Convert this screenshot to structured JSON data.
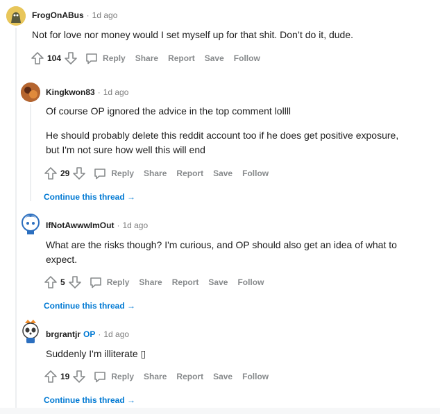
{
  "comments": [
    {
      "user": "FrogOnABus",
      "time": "1d ago",
      "body": "Not for love nor money would I set myself up for that shit. Don’t do it, dude.",
      "score": "104",
      "actions": {
        "reply": "Reply",
        "share": "Share",
        "report": "Report",
        "save": "Save",
        "follow": "Follow"
      }
    },
    {
      "user": "Kingkwon83",
      "time": "1d ago",
      "body1": "Of course OP ignored the advice in the top comment lollll",
      "body2": "He should probably delete this reddit account too if he does get positive exposure, but I'm not sure how well this will end",
      "score": "29",
      "actions": {
        "reply": "Reply",
        "share": "Share",
        "report": "Report",
        "save": "Save",
        "follow": "Follow"
      },
      "continue": "Continue this thread →"
    },
    {
      "user": "IfNotAwwwImOut",
      "time": "1d ago",
      "body": "What are the risks though? I'm curious, and OP should also get an idea of what to expect.",
      "score": "5",
      "actions": {
        "reply": "Reply",
        "share": "Share",
        "report": "Report",
        "save": "Save",
        "follow": "Follow"
      },
      "continue": "Continue this thread →"
    },
    {
      "user": "brgrantjr",
      "op_badge": "OP",
      "time": "1d ago",
      "body": "Suddenly I'm illiterate ▯",
      "score": "19",
      "actions": {
        "reply": "Reply",
        "share": "Share",
        "report": "Report",
        "save": "Save",
        "follow": "Follow"
      },
      "continue": "Continue this thread →"
    }
  ],
  "separator": "·",
  "icons": [
    "upvote-icon",
    "downvote-icon",
    "reply-bubble-icon"
  ],
  "colors": {
    "link": "#0079d3",
    "muted": "#878a8c",
    "text": "#1c1c1c",
    "thread_line": "#edeff1"
  }
}
